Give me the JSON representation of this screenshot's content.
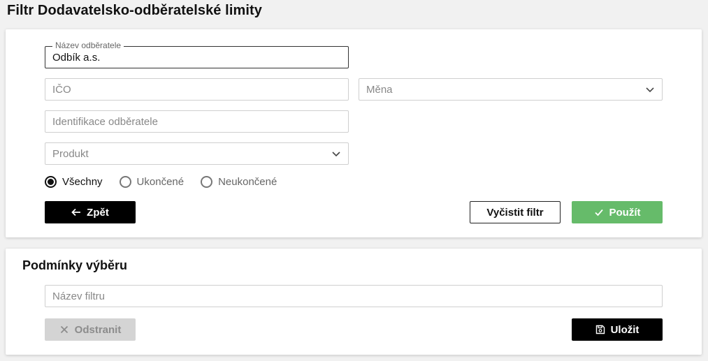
{
  "page": {
    "title": "Filtr Dodavatelsko-odběratelské limity"
  },
  "filter": {
    "customer_name": {
      "label": "Název odběratele",
      "value": "Odbík a.s."
    },
    "ico": {
      "placeholder": "IČO"
    },
    "currency": {
      "placeholder": "Měna"
    },
    "customer_id": {
      "placeholder": "Identifikace odběratele"
    },
    "product": {
      "placeholder": "Produkt"
    },
    "status_options": [
      {
        "label": "Všechny",
        "selected": true
      },
      {
        "label": "Ukončené",
        "selected": false
      },
      {
        "label": "Neukončené",
        "selected": false
      }
    ],
    "back_label": "Zpět",
    "clear_label": "Vyčistit filtr",
    "apply_label": "Použít"
  },
  "conditions": {
    "title": "Podmínky výběru",
    "filter_name": {
      "placeholder": "Název filtru"
    },
    "remove_label": "Odstranit",
    "save_label": "Uložit"
  },
  "colors": {
    "apply": "#66bb6a",
    "primary": "#000000",
    "disabled": "#d4d4d4"
  }
}
